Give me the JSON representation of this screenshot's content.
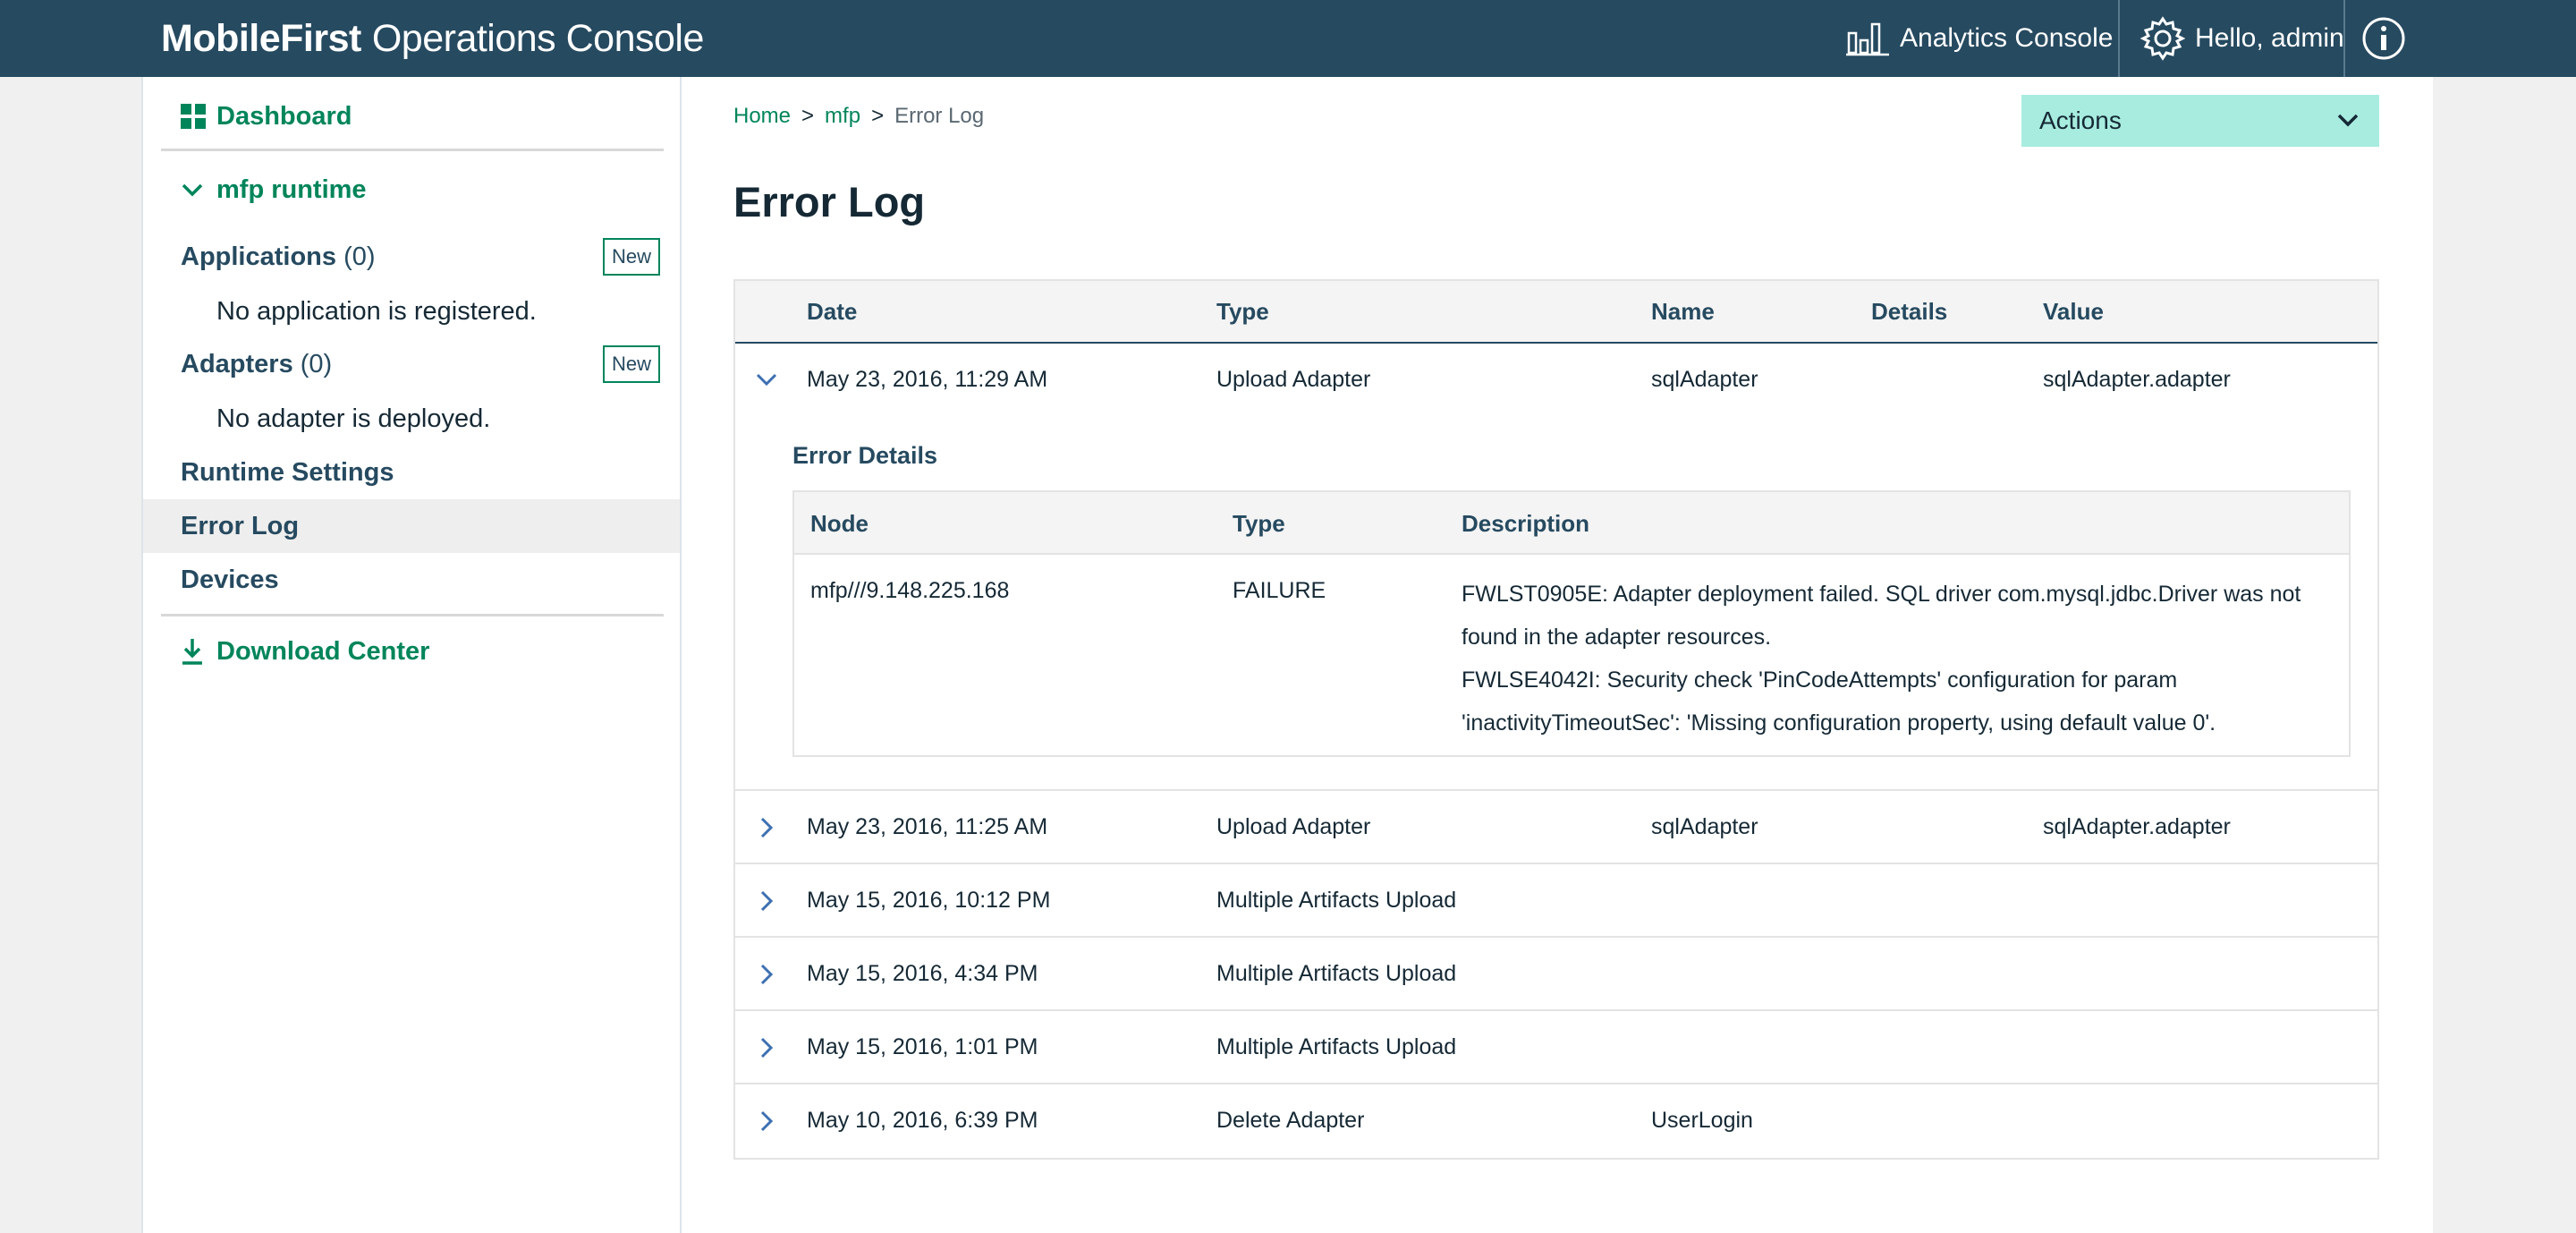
{
  "header": {
    "brand_bold": "MobileFirst",
    "brand_light": "Operations Console",
    "analytics": "Analytics Console",
    "user": "Hello, admin",
    "bg_color": "#264a60"
  },
  "sidebar": {
    "dashboard": "Dashboard",
    "runtime": "mfp runtime",
    "applications": {
      "label": "Applications",
      "count": "(0)",
      "new": "New",
      "empty": "No application is registered."
    },
    "adapters": {
      "label": "Adapters",
      "count": "(0)",
      "new": "New",
      "empty": "No adapter is deployed."
    },
    "nav": [
      "Runtime Settings",
      "Error Log",
      "Devices"
    ],
    "active": "Error Log",
    "download": "Download Center",
    "accent_color": "#00855a"
  },
  "breadcrumb": {
    "home": "Home",
    "mfp": "mfp",
    "sep": ">",
    "current": "Error Log"
  },
  "actions": {
    "label": "Actions",
    "bg_color": "#a7ecdf"
  },
  "page_title": "Error Log",
  "table": {
    "columns": [
      "Date",
      "Type",
      "Name",
      "Details",
      "Value"
    ],
    "rows": [
      {
        "date": "May 23, 2016, 11:29 AM",
        "type": "Upload Adapter",
        "name": "sqlAdapter",
        "value": "sqlAdapter.adapter",
        "expanded": true
      },
      {
        "date": "May 23, 2016, 11:25 AM",
        "type": "Upload Adapter",
        "name": "sqlAdapter",
        "value": "sqlAdapter.adapter"
      },
      {
        "date": "May 15, 2016, 10:12 PM",
        "type": "Multiple Artifacts Upload",
        "name": "",
        "value": ""
      },
      {
        "date": "May 15, 2016, 4:34 PM",
        "type": "Multiple Artifacts Upload",
        "name": "",
        "value": ""
      },
      {
        "date": "May 15, 2016, 1:01 PM",
        "type": "Multiple Artifacts Upload",
        "name": "",
        "value": ""
      },
      {
        "date": "May 10, 2016, 6:39 PM",
        "type": "Delete Adapter",
        "name": "UserLogin",
        "value": ""
      }
    ]
  },
  "error_details": {
    "title": "Error Details",
    "columns": [
      "Node",
      "Type",
      "Description"
    ],
    "node": "mfp///9.148.225.168",
    "type": "FAILURE",
    "description": [
      "FWLST0905E: Adapter deployment failed. SQL driver com.mysql.jdbc.Driver was not found in the adapter resources.",
      "FWLSE4042I: Security check 'PinCodeAttempts' configuration for param 'inactivityTimeoutSec': 'Missing configuration property, using default value 0'."
    ]
  },
  "icons": {
    "dashboard": "grid-icon",
    "runtime": "chevron-down-icon",
    "download": "download-icon",
    "analytics": "bar-chart-icon",
    "user": "gear-icon",
    "info": "info-icon",
    "actions": "chevron-down-icon",
    "row_expand": "chevron-right-icon",
    "row_collapse": "chevron-down-icon"
  }
}
